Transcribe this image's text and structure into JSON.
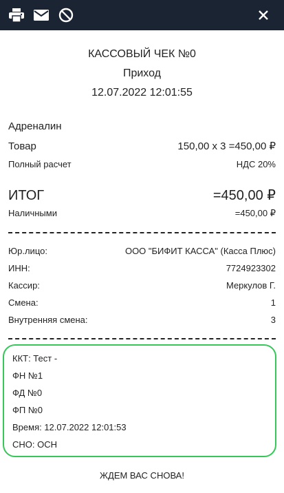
{
  "toolbar": {
    "print_icon": "printer-icon",
    "mail_icon": "envelope-icon",
    "cancel_icon": "block-icon",
    "close_icon": "close-icon",
    "background": "#1b2433"
  },
  "receipt": {
    "title": "КАССОВЫЙ ЧЕК №0",
    "operation": "Приход",
    "datetime": "12.07.2022 12:01:55",
    "item": {
      "name": "Адреналин",
      "type_label": "Товар",
      "price_line": "150,00 x 3 =450,00 ₽",
      "payment_method": "Полный расчет",
      "vat": "НДС 20%"
    },
    "total": {
      "label": "ИТОГ",
      "value": "=450,00 ₽",
      "cash_label": "Наличными",
      "cash_value": "=450,00 ₽"
    },
    "org": [
      {
        "label": "Юр.лицо:",
        "value": "ООО \"БИФИТ КАССА\" (Касса Плюс)"
      },
      {
        "label": "ИНН:",
        "value": "7724923302"
      },
      {
        "label": "Кассир:",
        "value": "Меркулов Г."
      },
      {
        "label": "Смена:",
        "value": "1"
      },
      {
        "label": "Внутренняя смена:",
        "value": "3"
      }
    ],
    "kkt": [
      "ККТ: Тест -",
      "ФН №1",
      "ФД №0",
      "ФП №0",
      "Время: 12.07.2022 12:01:53",
      "СНО: ОСН"
    ],
    "kkt_box_color": "#35c758",
    "footer": "ЖДЕМ ВАС СНОВА!"
  }
}
